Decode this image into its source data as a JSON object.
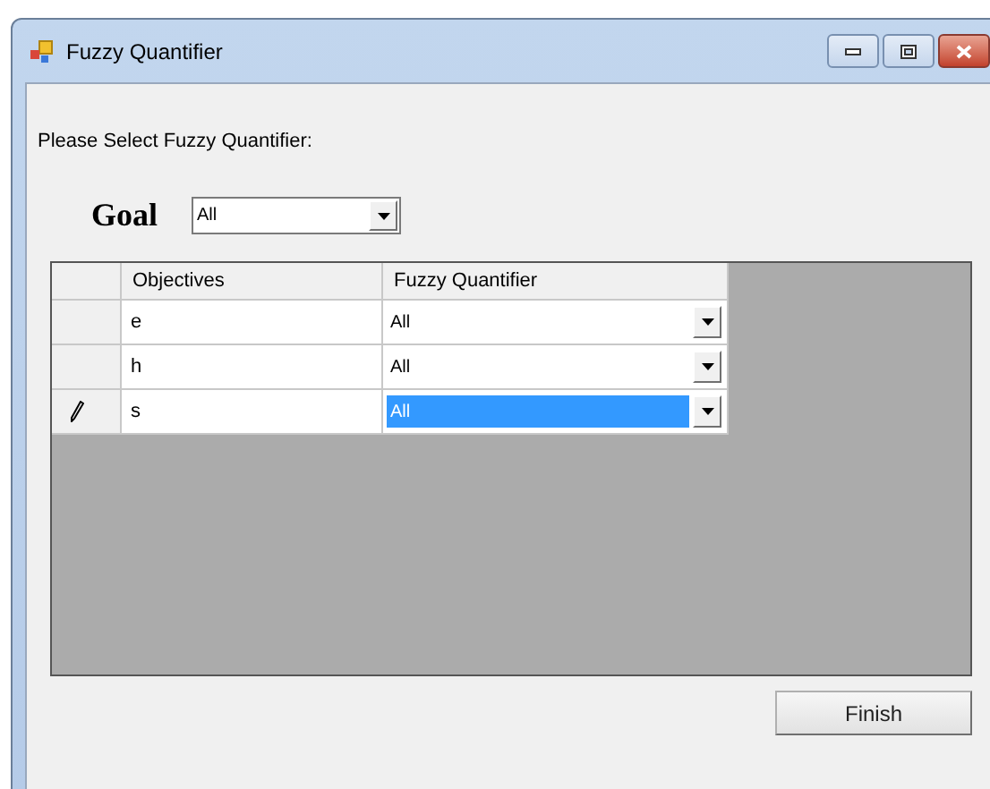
{
  "window": {
    "title": "Fuzzy Quantifier"
  },
  "prompt": "Please Select Fuzzy Quantifier:",
  "goal": {
    "label": "Goal",
    "value": "All"
  },
  "table": {
    "columns": [
      "Objectives",
      "Fuzzy Quantifier"
    ],
    "rows": [
      {
        "objective": "e",
        "quantifier": "All",
        "selected": false
      },
      {
        "objective": "h",
        "quantifier": "All",
        "selected": false
      },
      {
        "objective": "s",
        "quantifier": "All",
        "selected": true
      }
    ]
  },
  "buttons": [
    "Finish"
  ]
}
